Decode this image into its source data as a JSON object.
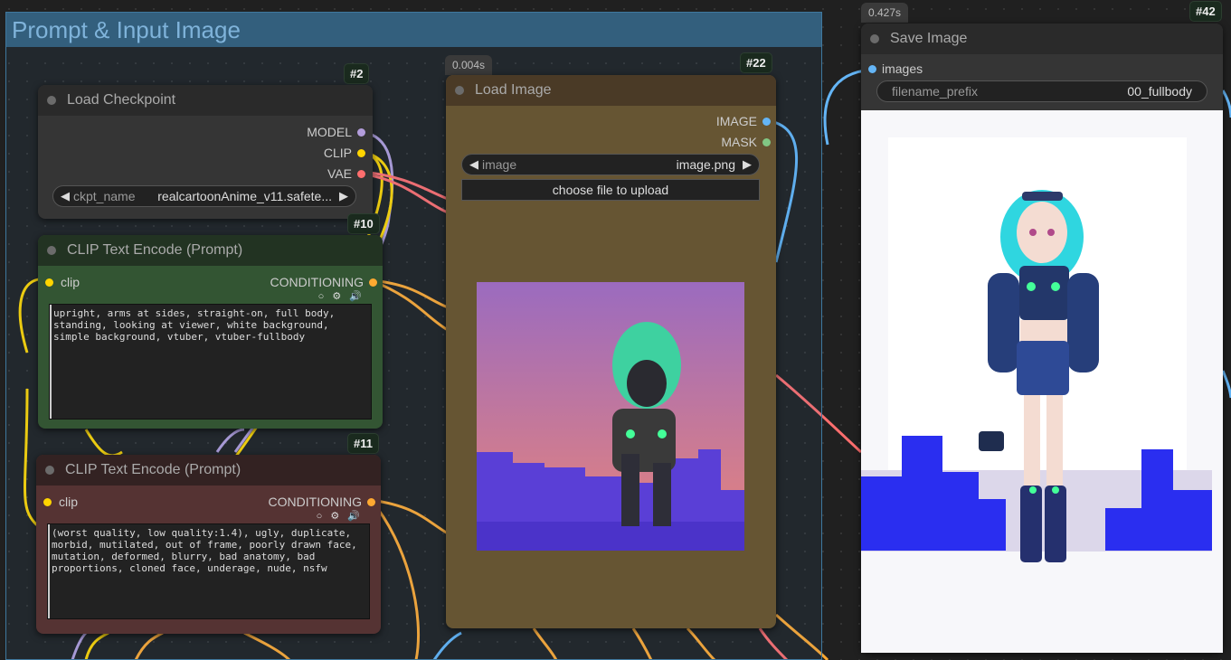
{
  "group": {
    "title": "Prompt & Input Image"
  },
  "nodes": {
    "load_checkpoint": {
      "id": "#2",
      "title": "Load Checkpoint",
      "outputs": [
        "MODEL",
        "CLIP",
        "VAE"
      ],
      "ckpt_label": "ckpt_name",
      "ckpt_value": "realcartoonAnime_v11.safete..."
    },
    "clip_pos": {
      "id": "#10",
      "title": "CLIP Text Encode (Prompt)",
      "input": "clip",
      "output": "CONDITIONING",
      "text": "upright, arms at sides, straight-on, full body, standing, looking at viewer, white background, simple background, vtuber, vtuber-fullbody"
    },
    "clip_neg": {
      "id": "#11",
      "title": "CLIP Text Encode (Prompt)",
      "input": "clip",
      "output": "CONDITIONING",
      "text": "(worst quality, low quality:1.4), ugly, duplicate, morbid, mutilated, out of frame, poorly drawn face, mutation, deformed, blurry, bad anatomy, bad proportions, cloned face, underage, nude, nsfw"
    },
    "load_image": {
      "id": "#22",
      "timing": "0.004s",
      "title": "Load Image",
      "outputs": [
        "IMAGE",
        "MASK"
      ],
      "image_label": "image",
      "image_value": "image.png",
      "upload_label": "choose file to upload"
    },
    "save_image": {
      "id": "#42",
      "timing": "0.427s",
      "title": "Save Image",
      "input": "images",
      "prefix_label": "filename_prefix",
      "prefix_value": "00_fullbody"
    }
  },
  "icons": {
    "combo_left": "◀",
    "combo_right": "▶",
    "widget_icons": "○ ⚙ 🔊"
  },
  "colors": {
    "model": "#b39ddb",
    "clip": "#ffd500",
    "vae": "#ff6e6e",
    "conditioning": "#ffa931",
    "image": "#64b5f6",
    "mask": "#81c784"
  }
}
